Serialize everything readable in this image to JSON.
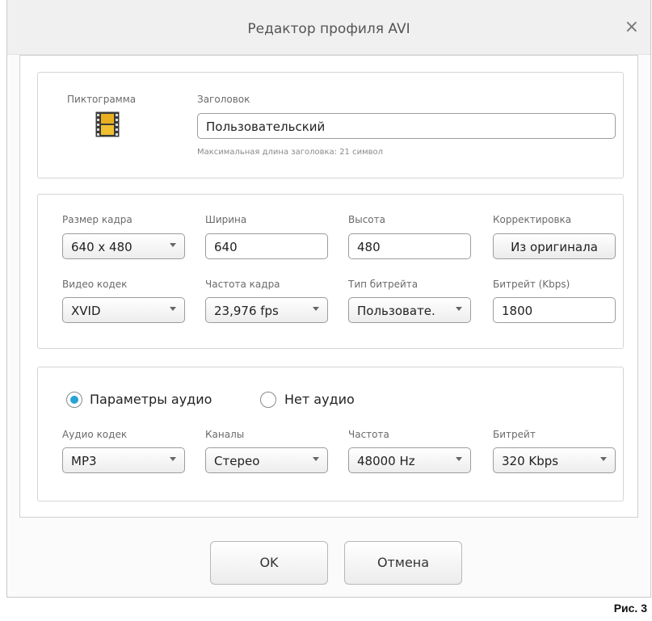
{
  "window": {
    "title": "Редактор профиля AVI",
    "close_icon": "×"
  },
  "header_panel": {
    "icon_label": "Пиктограмма",
    "title_label": "Заголовок",
    "title_value": "Пользовательский",
    "title_hint": "Максимальная длина заголовка: 21 символ"
  },
  "video": {
    "frame_size": {
      "label": "Размер кадра",
      "value": "640 x 480"
    },
    "width": {
      "label": "Ширина",
      "value": "640"
    },
    "height": {
      "label": "Высота",
      "value": "480"
    },
    "correction": {
      "label": "Корректировка",
      "button": "Из оригинала"
    },
    "codec": {
      "label": "Видео кодек",
      "value": "XVID"
    },
    "framerate": {
      "label": "Частота кадра",
      "value": "23,976 fps"
    },
    "bitrate_type": {
      "label": "Тип битрейта",
      "value": "Пользовате."
    },
    "bitrate": {
      "label": "Битрейт (Kbps)",
      "value": "1800"
    }
  },
  "audio": {
    "radio_params": "Параметры аудио",
    "radio_none": "Нет аудио",
    "selected": "params",
    "codec": {
      "label": "Аудио кодек",
      "value": "MP3"
    },
    "channels": {
      "label": "Каналы",
      "value": "Стерео"
    },
    "frequency": {
      "label": "Частота",
      "value": "48000 Hz"
    },
    "bitrate": {
      "label": "Битрейт",
      "value": "320 Kbps"
    }
  },
  "footer": {
    "ok": "OK",
    "cancel": "Отмена"
  },
  "caption": "Рис. 3",
  "colors": {
    "accent": "#27a3d8",
    "film_icon": "#e8b020"
  }
}
